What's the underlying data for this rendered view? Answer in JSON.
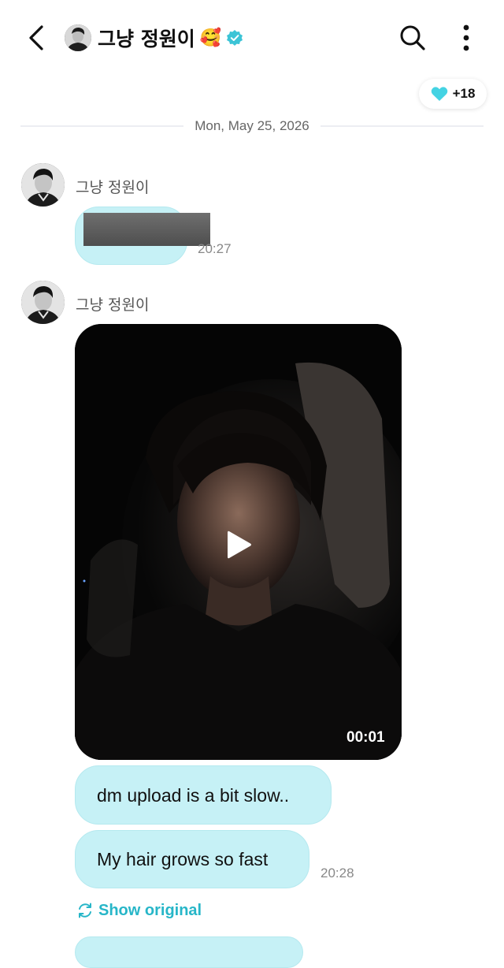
{
  "header": {
    "title": "그냥 정원이",
    "title_emoji": "🥰",
    "back_icon": "chevron-left-icon",
    "search_icon": "search-icon",
    "more_icon": "more-vertical-icon",
    "verified_color": "#3cc4d6"
  },
  "reactions": {
    "icon": "heart-icon",
    "count": "+18",
    "heart_color": "#44d3e3"
  },
  "date_divider": "Mon, May 25, 2026",
  "messages": [
    {
      "sender": "그냥 정원이",
      "type": "redacted-text",
      "time": "20:27"
    },
    {
      "sender": "그냥 정원이",
      "type": "video",
      "duration": "00:01"
    },
    {
      "type": "text",
      "text": "dm upload is a bit slow.."
    },
    {
      "type": "text",
      "text": "My hair grows so fast",
      "time": "20:28"
    }
  ],
  "show_original": {
    "label": "Show original",
    "icon": "translate-refresh-icon"
  },
  "colors": {
    "bubble": "#c6f1f6",
    "accent": "#27b6c8"
  }
}
